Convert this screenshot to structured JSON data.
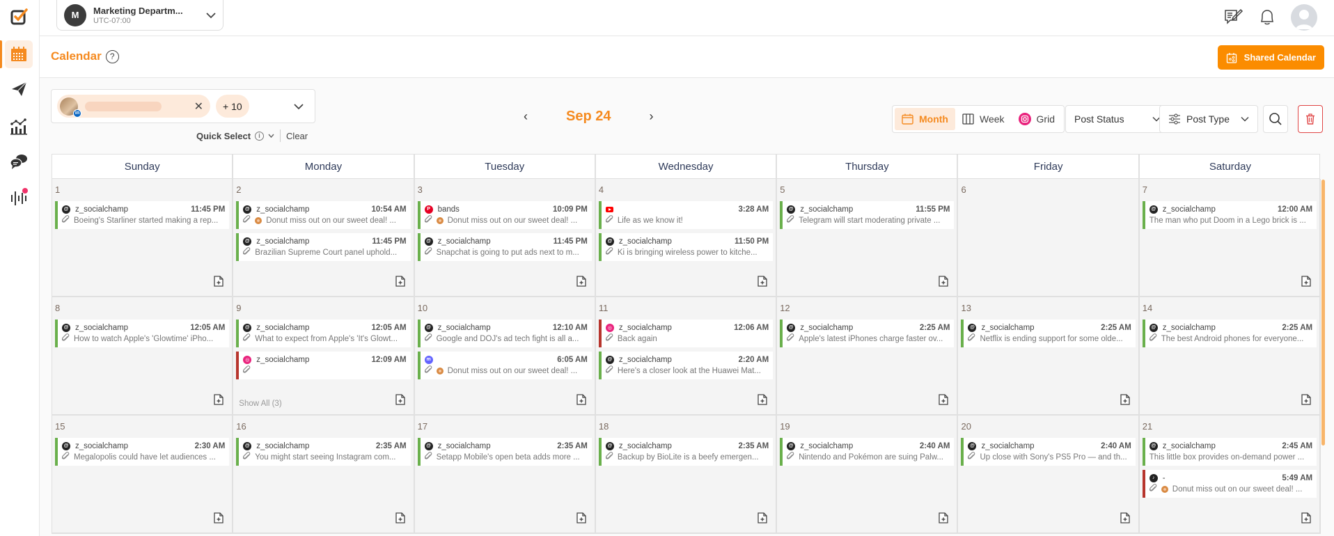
{
  "workspace": {
    "initial": "M",
    "name": "Marketing Departm...",
    "timezone": "UTC-07:00"
  },
  "sidebar": {
    "items": [
      {
        "name": "calendar",
        "active": true
      },
      {
        "name": "publish",
        "active": false
      },
      {
        "name": "analytics",
        "active": false
      },
      {
        "name": "engage",
        "active": false
      },
      {
        "name": "listening",
        "active": false,
        "notification": true
      }
    ]
  },
  "header": {
    "title": "Calendar",
    "shared_button": "Shared Calendar"
  },
  "filters": {
    "account_network": "in",
    "more_count": "+ 10",
    "quick_select": "Quick Select",
    "clear": "Clear"
  },
  "nav": {
    "month": "Sep 24",
    "prev": "‹",
    "next": "›"
  },
  "views": [
    {
      "label": "Month",
      "active": true
    },
    {
      "label": "Week",
      "active": false
    },
    {
      "label": "Grid",
      "active": false
    }
  ],
  "dropdowns": {
    "post_status": "Post Status",
    "post_type": "Post Type"
  },
  "colors": {
    "accent": "#f58a1f",
    "shared_btn": "#fb8c00",
    "published": "#6ab04c",
    "failed": "#b7352d"
  },
  "calendar": {
    "weekdays": [
      "Sunday",
      "Monday",
      "Tuesday",
      "Wednesday",
      "Thursday",
      "Friday",
      "Saturday"
    ],
    "days": [
      {
        "day": "1",
        "posts": [
          {
            "net": "threads",
            "name": "z_socialchamp",
            "time": "11:45 PM",
            "text": "Boeing's Starliner started making a rep...",
            "clip": true,
            "status": "green"
          }
        ]
      },
      {
        "day": "2",
        "posts": [
          {
            "net": "threads",
            "name": "z_socialchamp",
            "time": "10:54 AM",
            "text": "Donut miss out on our sweet deal! ...",
            "clip": true,
            "donut": true,
            "status": "green"
          },
          {
            "net": "threads",
            "name": "z_socialchamp",
            "time": "11:45 PM",
            "text": "Brazilian Supreme Court panel uphold...",
            "clip": true,
            "status": "green"
          }
        ]
      },
      {
        "day": "3",
        "posts": [
          {
            "net": "pinterest",
            "name": "bands",
            "time": "10:09 PM",
            "text": "Donut miss out on our sweet deal! ...",
            "clip": true,
            "donut": true,
            "status": "green"
          },
          {
            "net": "threads",
            "name": "z_socialchamp",
            "time": "11:45 PM",
            "text": "Snapchat is going to put ads next to m...",
            "clip": true,
            "status": "green"
          }
        ]
      },
      {
        "day": "4",
        "posts": [
          {
            "net": "youtube",
            "name": "",
            "time": "3:28 AM",
            "text": "Life as we know it!",
            "clip": true,
            "status": "green"
          },
          {
            "net": "threads",
            "name": "z_socialchamp",
            "time": "11:50 PM",
            "text": "Ki is bringing wireless power to kitche...",
            "clip": true,
            "status": "green"
          }
        ]
      },
      {
        "day": "5",
        "posts": [
          {
            "net": "threads",
            "name": "z_socialchamp",
            "time": "11:55 PM",
            "text": "Telegram will start moderating private ...",
            "clip": true,
            "status": "green"
          }
        ]
      },
      {
        "day": "6",
        "posts": []
      },
      {
        "day": "7",
        "posts": [
          {
            "net": "threads",
            "name": "z_socialchamp",
            "time": "12:00 AM",
            "text": "The man who put Doom in a Lego brick is ...",
            "clip": false,
            "status": "green"
          }
        ]
      },
      {
        "day": "8",
        "posts": [
          {
            "net": "threads",
            "name": "z_socialchamp",
            "time": "12:05 AM",
            "text": "How to watch Apple's 'Glowtime' iPho...",
            "clip": true,
            "status": "green"
          }
        ]
      },
      {
        "day": "9",
        "show_all": "Show All (3)",
        "posts": [
          {
            "net": "threads",
            "name": "z_socialchamp",
            "time": "12:05 AM",
            "text": "What to expect from Apple's 'It's Glowt...",
            "clip": true,
            "status": "green"
          },
          {
            "net": "instagram",
            "name": "z_socialchamp",
            "time": "12:09 AM",
            "text": "",
            "clip": true,
            "status": "red"
          }
        ]
      },
      {
        "day": "10",
        "posts": [
          {
            "net": "threads",
            "name": "z_socialchamp",
            "time": "12:10 AM",
            "text": "Google and DOJ's ad tech fight is all a...",
            "clip": true,
            "status": "green"
          },
          {
            "net": "mastodon",
            "name": "",
            "time": "6:05 AM",
            "text": "Donut miss out on our sweet deal! ...",
            "clip": true,
            "donut": true,
            "status": "green"
          }
        ]
      },
      {
        "day": "11",
        "posts": [
          {
            "net": "instagram",
            "name": "z_socialchamp",
            "time": "12:06 AM",
            "text": "Back again",
            "clip": true,
            "status": "red"
          },
          {
            "net": "threads",
            "name": "z_socialchamp",
            "time": "2:20 AM",
            "text": "Here's a closer look at the Huawei Mat...",
            "clip": true,
            "status": "green"
          }
        ]
      },
      {
        "day": "12",
        "posts": [
          {
            "net": "threads",
            "name": "z_socialchamp",
            "time": "2:25 AM",
            "text": "Apple's latest iPhones charge faster ov...",
            "clip": true,
            "status": "green"
          }
        ]
      },
      {
        "day": "13",
        "posts": [
          {
            "net": "threads",
            "name": "z_socialchamp",
            "time": "2:25 AM",
            "text": "Netflix is ending support for some olde...",
            "clip": true,
            "status": "green"
          }
        ]
      },
      {
        "day": "14",
        "posts": [
          {
            "net": "threads",
            "name": "z_socialchamp",
            "time": "2:25 AM",
            "text": "The best Android phones for everyone...",
            "clip": true,
            "status": "green"
          }
        ]
      },
      {
        "day": "15",
        "posts": [
          {
            "net": "threads",
            "name": "z_socialchamp",
            "time": "2:30 AM",
            "text": "Megalopolis could have let audiences ...",
            "clip": true,
            "status": "green"
          }
        ]
      },
      {
        "day": "16",
        "posts": [
          {
            "net": "threads",
            "name": "z_socialchamp",
            "time": "2:35 AM",
            "text": "You might start seeing Instagram com...",
            "clip": true,
            "status": "green"
          }
        ]
      },
      {
        "day": "17",
        "posts": [
          {
            "net": "threads",
            "name": "z_socialchamp",
            "time": "2:35 AM",
            "text": "Setapp Mobile's open beta adds more ...",
            "clip": true,
            "status": "green"
          }
        ]
      },
      {
        "day": "18",
        "posts": [
          {
            "net": "threads",
            "name": "z_socialchamp",
            "time": "2:35 AM",
            "text": "Backup by BioLite is a beefy emergen...",
            "clip": true,
            "status": "green"
          }
        ]
      },
      {
        "day": "19",
        "posts": [
          {
            "net": "threads",
            "name": "z_socialchamp",
            "time": "2:40 AM",
            "text": "Nintendo and Pokémon are suing Palw...",
            "clip": true,
            "status": "green"
          }
        ]
      },
      {
        "day": "20",
        "posts": [
          {
            "net": "threads",
            "name": "z_socialchamp",
            "time": "2:40 AM",
            "text": "Up close with Sony's PS5 Pro — and th...",
            "clip": true,
            "status": "green"
          }
        ]
      },
      {
        "day": "21",
        "posts": [
          {
            "net": "threads",
            "name": "z_socialchamp",
            "time": "2:45 AM",
            "text": "This little box provides on-demand power ...",
            "clip": false,
            "status": "green"
          },
          {
            "net": "tiktok",
            "name": "-",
            "time": "5:49 AM",
            "text": "Donut miss out on our sweet deal! ...",
            "clip": true,
            "donut": true,
            "status": "red"
          }
        ]
      }
    ]
  }
}
